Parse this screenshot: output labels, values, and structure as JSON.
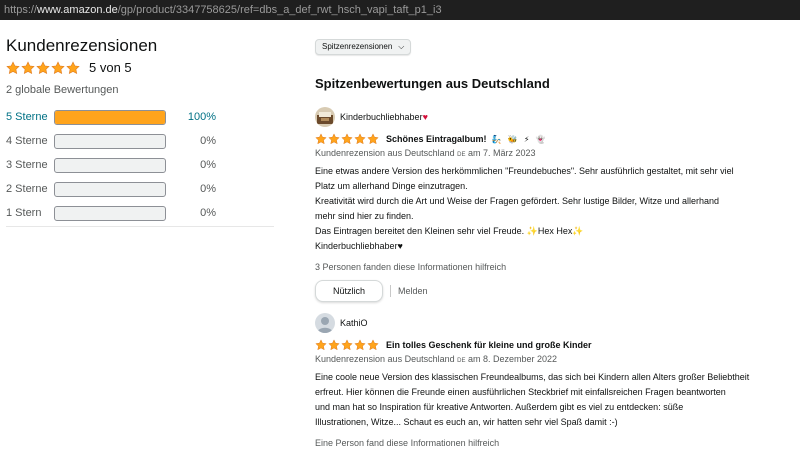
{
  "browser": {
    "url_scheme": "https://",
    "url_host": "www.amazon.de",
    "url_path": "/gp/product/3347758625/ref=dbs_a_def_rwt_hsch_vapi_taft_p1_i3"
  },
  "summary": {
    "heading": "Kundenrezensionen",
    "rating_text": "5 von 5",
    "rating": 5,
    "global_count": "2 globale Bewertungen",
    "histogram": [
      {
        "label": "5 Sterne",
        "percent_text": "100%",
        "fraction": 1.0
      },
      {
        "label": "4 Sterne",
        "percent_text": "0%",
        "fraction": 0
      },
      {
        "label": "3 Sterne",
        "percent_text": "0%",
        "fraction": 0
      },
      {
        "label": "2 Sterne",
        "percent_text": "0%",
        "fraction": 0
      },
      {
        "label": "1 Stern",
        "percent_text": "0%",
        "fraction": 0
      }
    ]
  },
  "reviews_section": {
    "sort_label": "Spitzenrezensionen",
    "heading": "Spitzenbewertungen aus Deutschland"
  },
  "reviews": [
    {
      "author": "Kinderbuchliebhaber",
      "author_suffix": "♥",
      "rating": 5,
      "title": "Schönes Eintragalbum!",
      "title_emojis": "🧞 🐝 ⚡ 👻",
      "meta_prefix": "Kundenrezension aus Deutschland",
      "meta_flag": "DE",
      "meta_date": "am 7. März 2023",
      "body_lines": [
        "Eine etwas andere Version des herkömmlichen \"Freundebuches\". Sehr ausführlich gestaltet, mit sehr viel",
        "Platz um allerhand Dinge einzutragen.",
        "Kreativität wird durch die Art und Weise der Fragen gefördert. Sehr lustige Bilder, Witze und allerhand",
        "mehr sind hier zu finden.",
        "Das Eintragen bereitet den Kleinen sehr viel Freude. ✨Hex Hex✨",
        "Kinderbuchliebhaber♥"
      ],
      "helpful": "3 Personen fanden diese Informationen hilfreich",
      "helpful_button": "Nützlich",
      "report": "Melden"
    },
    {
      "author": "KathiO",
      "rating": 5,
      "title": "Ein tolles Geschenk für kleine und große Kinder",
      "meta_prefix": "Kundenrezension aus Deutschland",
      "meta_flag": "DE",
      "meta_date": "am 8. Dezember 2022",
      "body_lines": [
        "Eine coole neue Version des klassischen Freundealbums, das sich bei Kindern allen Alters großer Beliebtheit",
        "erfreut. Hier können die Freunde einen ausführlichen Steckbrief mit einfallsreichen Fragen beantworten",
        "und man hat so Inspiration für kreative Antworten. Außerdem gibt es viel zu entdecken: süße",
        "Illustrationen, Witze... Schaut es euch an, wir hatten sehr viel Spaß damit :-)"
      ],
      "helpful": "Eine Person fand diese Informationen hilfreich"
    }
  ],
  "colors": {
    "star": "#ffa41c",
    "link": "#007185",
    "text": "#0f1111",
    "muted": "#565959"
  }
}
